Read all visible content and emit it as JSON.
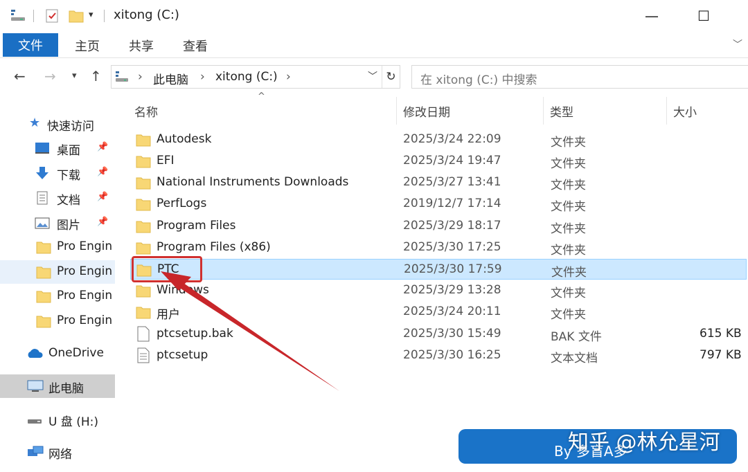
{
  "window": {
    "title": "xitong (C:)",
    "minimize": "—",
    "maximize": "☐",
    "close": "✕"
  },
  "ribbon": {
    "file": "文件",
    "home": "主页",
    "share": "共享",
    "view": "查看"
  },
  "address": {
    "root": "此电脑",
    "drive": "xitong (C:)",
    "search_placeholder": "在 xitong (C:) 中搜索"
  },
  "sidebar": {
    "quick_access": "快速访问",
    "desktop": "桌面",
    "downloads": "下载",
    "documents": "文档",
    "pictures": "图片",
    "recent_1": "Pro Engin",
    "recent_2": "Pro Engin",
    "recent_3": "Pro Engin",
    "recent_4": "Pro Engin",
    "onedrive": "OneDrive",
    "this_pc": "此电脑",
    "usb": "U 盘 (H:)",
    "network": "网络"
  },
  "columns": {
    "name": "名称",
    "modified": "修改日期",
    "type": "类型",
    "size": "大小"
  },
  "files": [
    {
      "name": "Autodesk",
      "date": "2025/3/24 22:09",
      "type": "文件夹",
      "size": ""
    },
    {
      "name": "EFI",
      "date": "2025/3/24 19:47",
      "type": "文件夹",
      "size": ""
    },
    {
      "name": "National Instruments Downloads",
      "date": "2025/3/27 13:41",
      "type": "文件夹",
      "size": ""
    },
    {
      "name": "PerfLogs",
      "date": "2019/12/7 17:14",
      "type": "文件夹",
      "size": ""
    },
    {
      "name": "Program Files",
      "date": "2025/3/29 18:17",
      "type": "文件夹",
      "size": ""
    },
    {
      "name": "Program Files (x86)",
      "date": "2025/3/30 17:25",
      "type": "文件夹",
      "size": ""
    },
    {
      "name": "PTC",
      "date": "2025/3/30 17:59",
      "type": "文件夹",
      "size": ""
    },
    {
      "name": "Windows",
      "date": "2025/3/29 13:28",
      "type": "文件夹",
      "size": ""
    },
    {
      "name": "用户",
      "date": "2025/3/24 20:11",
      "type": "文件夹",
      "size": ""
    },
    {
      "name": "ptcsetup.bak",
      "date": "2025/3/30 15:49",
      "type": "BAK 文件",
      "size": "615 KB"
    },
    {
      "name": "ptcsetup",
      "date": "2025/3/30 16:25",
      "type": "文本文档",
      "size": "797 KB"
    }
  ],
  "watermark": {
    "text": "知乎 @林允星河",
    "by": "By 多盲A多"
  },
  "colors": {
    "accent": "#1a6fc4",
    "selection": "#cce8ff",
    "annotation": "#d0302f",
    "folder": "#f8d775"
  }
}
